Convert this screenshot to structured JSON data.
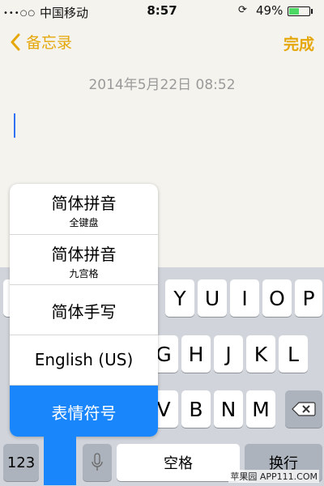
{
  "status_bar": {
    "signal": "•••○○",
    "carrier": "中国移动",
    "time": "8:57",
    "orientation_lock": "⟳",
    "battery_percent": "49%",
    "battery_level": 0.49
  },
  "nav": {
    "back_label": "备忘录",
    "done_label": "完成",
    "accent_color": "#e5a70a"
  },
  "note": {
    "date": "2014年5月22日 08:52",
    "cursor_color": "#2f72f5"
  },
  "keyboard": {
    "row1": [
      "Y",
      "U",
      "I",
      "O",
      "P"
    ],
    "row2": [
      "G",
      "H",
      "J",
      "K",
      "L"
    ],
    "row3": [
      "V",
      "B",
      "N",
      "M"
    ],
    "numbers_key": "123",
    "space_label": "空格",
    "return_label": "换行"
  },
  "language_menu": {
    "items": [
      {
        "title": "简体拼音",
        "subtitle": "全键盘"
      },
      {
        "title": "简体拼音",
        "subtitle": "九宫格"
      },
      {
        "title": "简体手写",
        "subtitle": ""
      },
      {
        "title": "English (US)",
        "subtitle": ""
      },
      {
        "title": "表情符号",
        "subtitle": "",
        "selected": true
      }
    ],
    "selected_color": "#1a86fb"
  },
  "watermark": "苹果园 APP111.COM"
}
